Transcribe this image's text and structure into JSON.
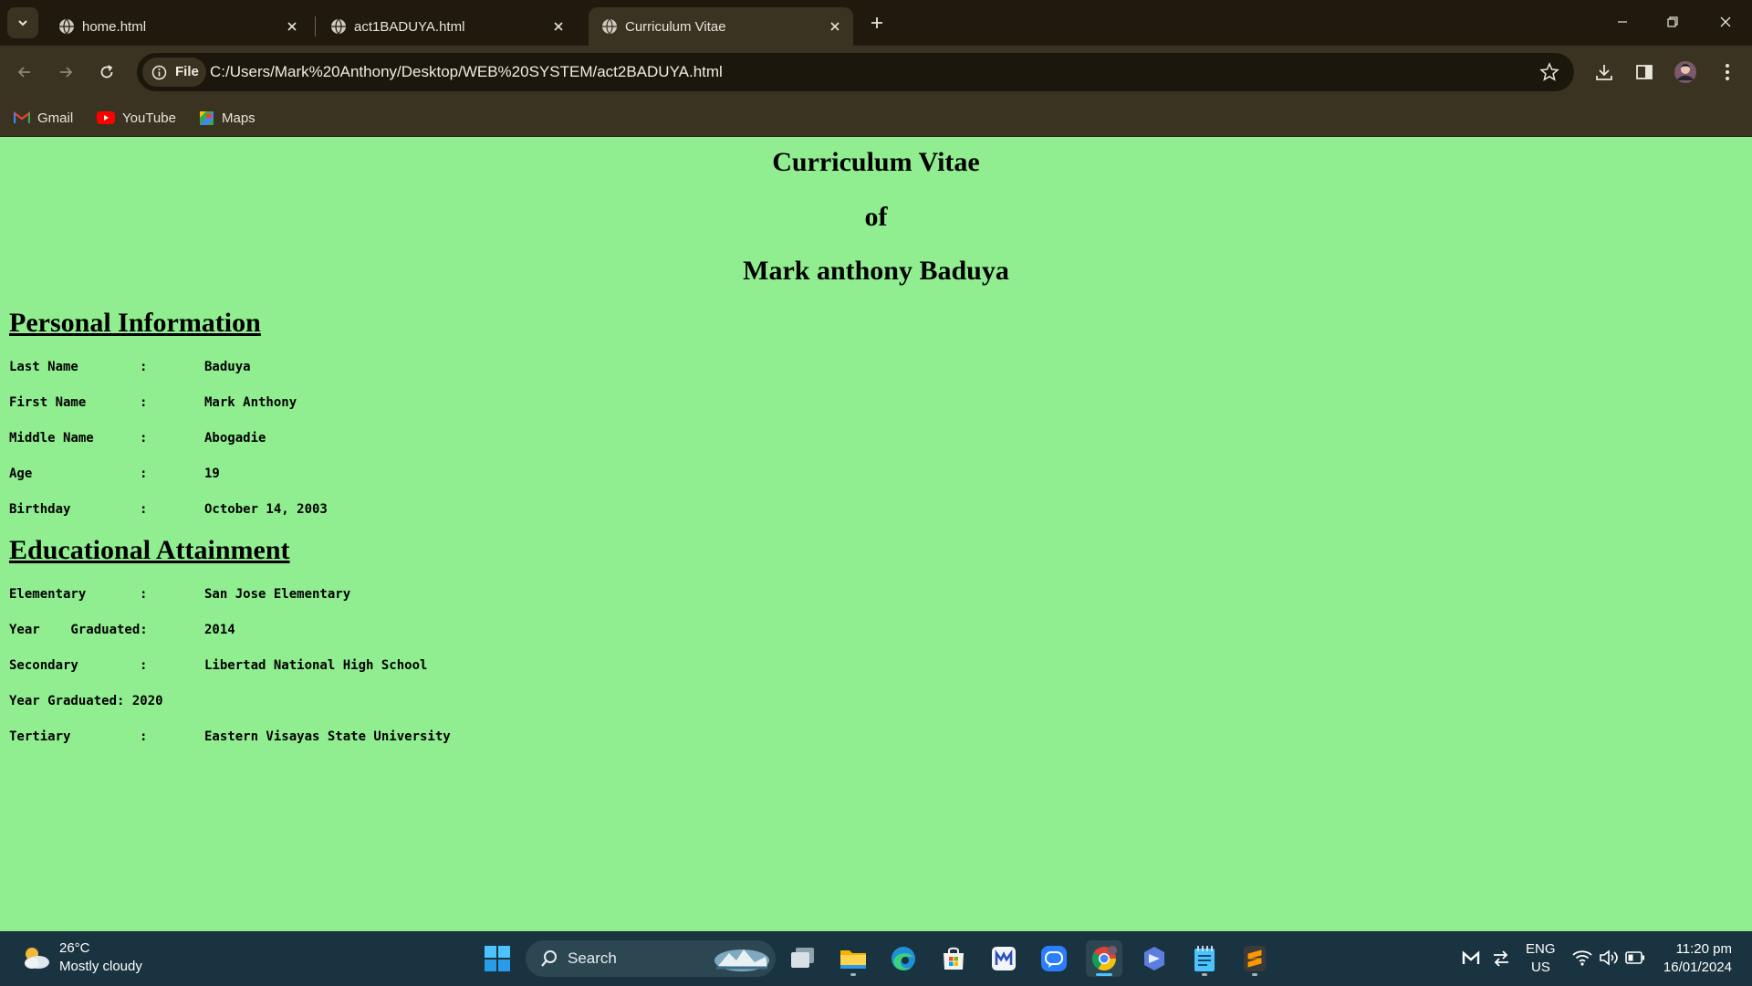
{
  "browser": {
    "tabs": [
      {
        "title": "home.html",
        "active": false
      },
      {
        "title": "act1BADUYA.html",
        "active": false
      },
      {
        "title": "Curriculum Vitae",
        "active": true
      }
    ],
    "omnibox": {
      "scheme_label": "File",
      "url": "C:/Users/Mark%20Anthony/Desktop/WEB%20SYSTEM/act2BADUYA.html"
    },
    "bookmarks": [
      {
        "label": "Gmail",
        "icon": "gmail-icon"
      },
      {
        "label": "YouTube",
        "icon": "youtube-icon"
      },
      {
        "label": "Maps",
        "icon": "maps-icon"
      }
    ]
  },
  "page": {
    "background_color": "#90EE90",
    "title_lines": [
      "Curriculum Vitae",
      "of",
      "Mark anthony Baduya"
    ],
    "personal": {
      "heading": "Personal Information",
      "rows": [
        {
          "label": "Last Name",
          "colon": ":",
          "value": "Baduya"
        },
        {
          "label": "First Name",
          "colon": ":",
          "value": "Mark Anthony"
        },
        {
          "label": "Middle Name",
          "colon": ":",
          "value": "Abogadie"
        },
        {
          "label": "Age",
          "colon": ":",
          "value": "19"
        },
        {
          "label": "Birthday",
          "colon": ":",
          "value": "October 14, 2003"
        }
      ]
    },
    "education": {
      "heading": "Educational Attainment",
      "rows": [
        {
          "label": "Elementary",
          "colon": ":",
          "value": "San Jose Elementary"
        },
        {
          "label": "Year    Graduated:",
          "colon": "",
          "value": "2014"
        },
        {
          "label": "Secondary",
          "colon": ":",
          "value": "Libertad National High School"
        },
        {
          "label": "Year Graduated: 2020",
          "colon": "",
          "value": ""
        },
        {
          "label": "Tertiary",
          "colon": ":",
          "value": "Eastern Visayas State University"
        }
      ]
    }
  },
  "taskbar": {
    "weather": {
      "temp": "26°C",
      "desc": "Mostly cloudy"
    },
    "search_label": "Search",
    "tray": {
      "lang": "ENG",
      "region": "US",
      "time": "11:20 pm",
      "date": "16/01/2024"
    }
  }
}
